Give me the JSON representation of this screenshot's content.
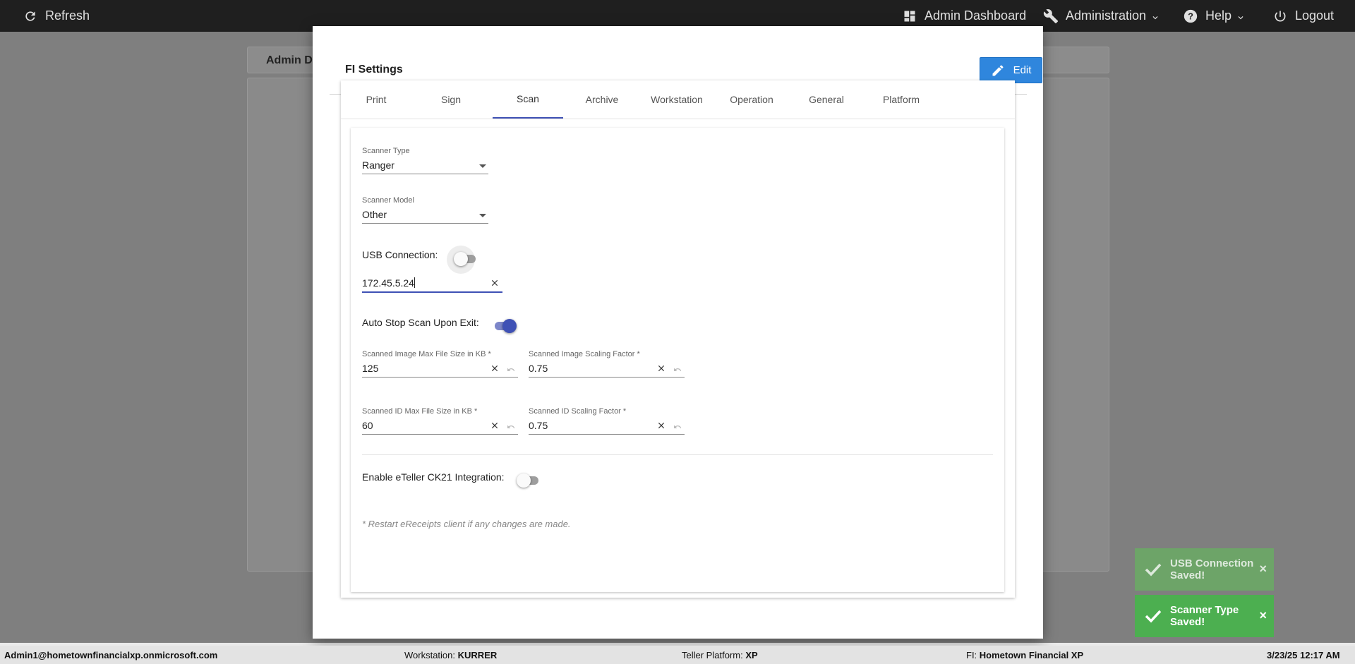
{
  "topbar": {
    "refresh": "Refresh",
    "admin_dashboard": "Admin Dashboard",
    "administration": "Administration",
    "help": "Help",
    "logout": "Logout"
  },
  "background": {
    "panel_title": "Admin D"
  },
  "modal": {
    "title": "FI Settings",
    "edit_label": "Edit",
    "tabs": [
      "Print",
      "Sign",
      "Scan",
      "Archive",
      "Workstation",
      "Operation",
      "General",
      "Platform"
    ],
    "active_tab": "Scan",
    "scan": {
      "scanner_type_label": "Scanner Type",
      "scanner_type_value": "Ranger",
      "scanner_model_label": "Scanner Model",
      "scanner_model_value": "Other",
      "usb_connection_label": "USB Connection:",
      "usb_connection_on": false,
      "ip_address_value": "172.45.5.24",
      "auto_stop_label": "Auto Stop Scan Upon Exit:",
      "auto_stop_on": true,
      "image_max_size_label": "Scanned Image Max File Size in KB *",
      "image_max_size_value": "125",
      "image_scaling_label": "Scanned Image Scaling Factor *",
      "image_scaling_value": "0.75",
      "id_max_size_label": "Scanned ID Max File Size in KB *",
      "id_max_size_value": "60",
      "id_scaling_label": "Scanned ID Scaling Factor *",
      "id_scaling_value": "0.75",
      "eteller_label": "Enable eTeller CK21 Integration:",
      "eteller_on": false,
      "restart_note": "* Restart eReceipts client if any changes are made."
    }
  },
  "toasts": [
    {
      "text": "USB Connection Saved!"
    },
    {
      "text": "Scanner Type Saved!"
    }
  ],
  "statusbar": {
    "user": "Admin1@hometownfinancialxp.onmicrosoft.com",
    "workstation_label": "Workstation:",
    "workstation_value": "KURRER",
    "platform_label": "Teller Platform:",
    "platform_value": "XP",
    "fi_label": "FI:",
    "fi_value": "Hometown Financial XP",
    "datetime": "3/23/25 12:17 AM"
  },
  "colors": {
    "accent": "#3f51b5",
    "edit_button": "#2f86dd",
    "toast_success": "#4caf50",
    "topbar": "#1f1f1f"
  }
}
